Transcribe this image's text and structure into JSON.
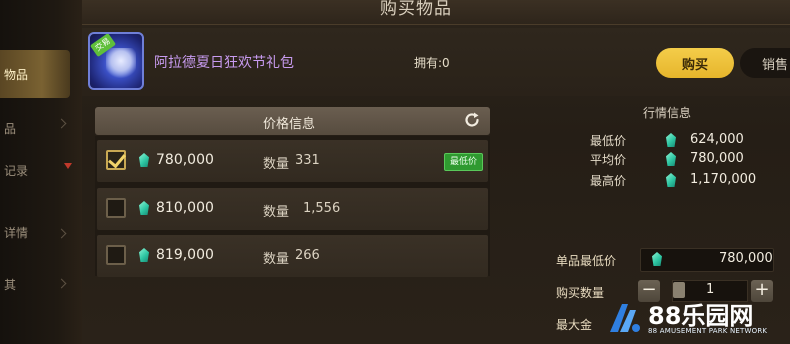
{
  "header": {
    "title": "购买物品"
  },
  "left_nav": {
    "items": [
      {
        "label": "物品",
        "active": true
      },
      {
        "label": "品",
        "active": false
      },
      {
        "label": "记录",
        "active": false
      },
      {
        "label": "详情",
        "active": false
      },
      {
        "label": "其",
        "active": false
      }
    ]
  },
  "item": {
    "name": "阿拉德夏日狂欢节礼包",
    "owned_label": "拥有:0",
    "badge": "交易",
    "icon": "gift-package-icon"
  },
  "tabs": {
    "buy": "购买",
    "sell": "销售"
  },
  "price_list": {
    "header": "价格信息",
    "qty_label": "数量",
    "lowest_tag": "最低价",
    "rows": [
      {
        "price": "780,000",
        "qty": "331",
        "checked": true,
        "lowest": true
      },
      {
        "price": "810,000",
        "qty": "1,556",
        "checked": false,
        "lowest": false
      },
      {
        "price": "819,000",
        "qty": "266",
        "checked": false,
        "lowest": false
      }
    ]
  },
  "market": {
    "title": "行情信息",
    "rows": [
      {
        "label": "最低价",
        "value": "624,000"
      },
      {
        "label": "平均价",
        "value": "780,000"
      },
      {
        "label": "最高价",
        "value": "1,170,000"
      }
    ]
  },
  "purchase": {
    "unit_price_label": "单品最低价",
    "unit_price": "780,000",
    "qty_label": "购买数量",
    "qty": "1",
    "max_label": "最大金",
    "minus": "−",
    "plus": "+"
  },
  "watermark": {
    "text": "88乐园网",
    "sub": "88 AMUSEMENT PARK NETWORK"
  },
  "colors": {
    "accent": "#f4cd4a",
    "item_name": "#c89bf0",
    "lowest_tag": "#2f9a30",
    "gem": "#2fc7a4",
    "watermark_blue": "#2f7fe0"
  }
}
